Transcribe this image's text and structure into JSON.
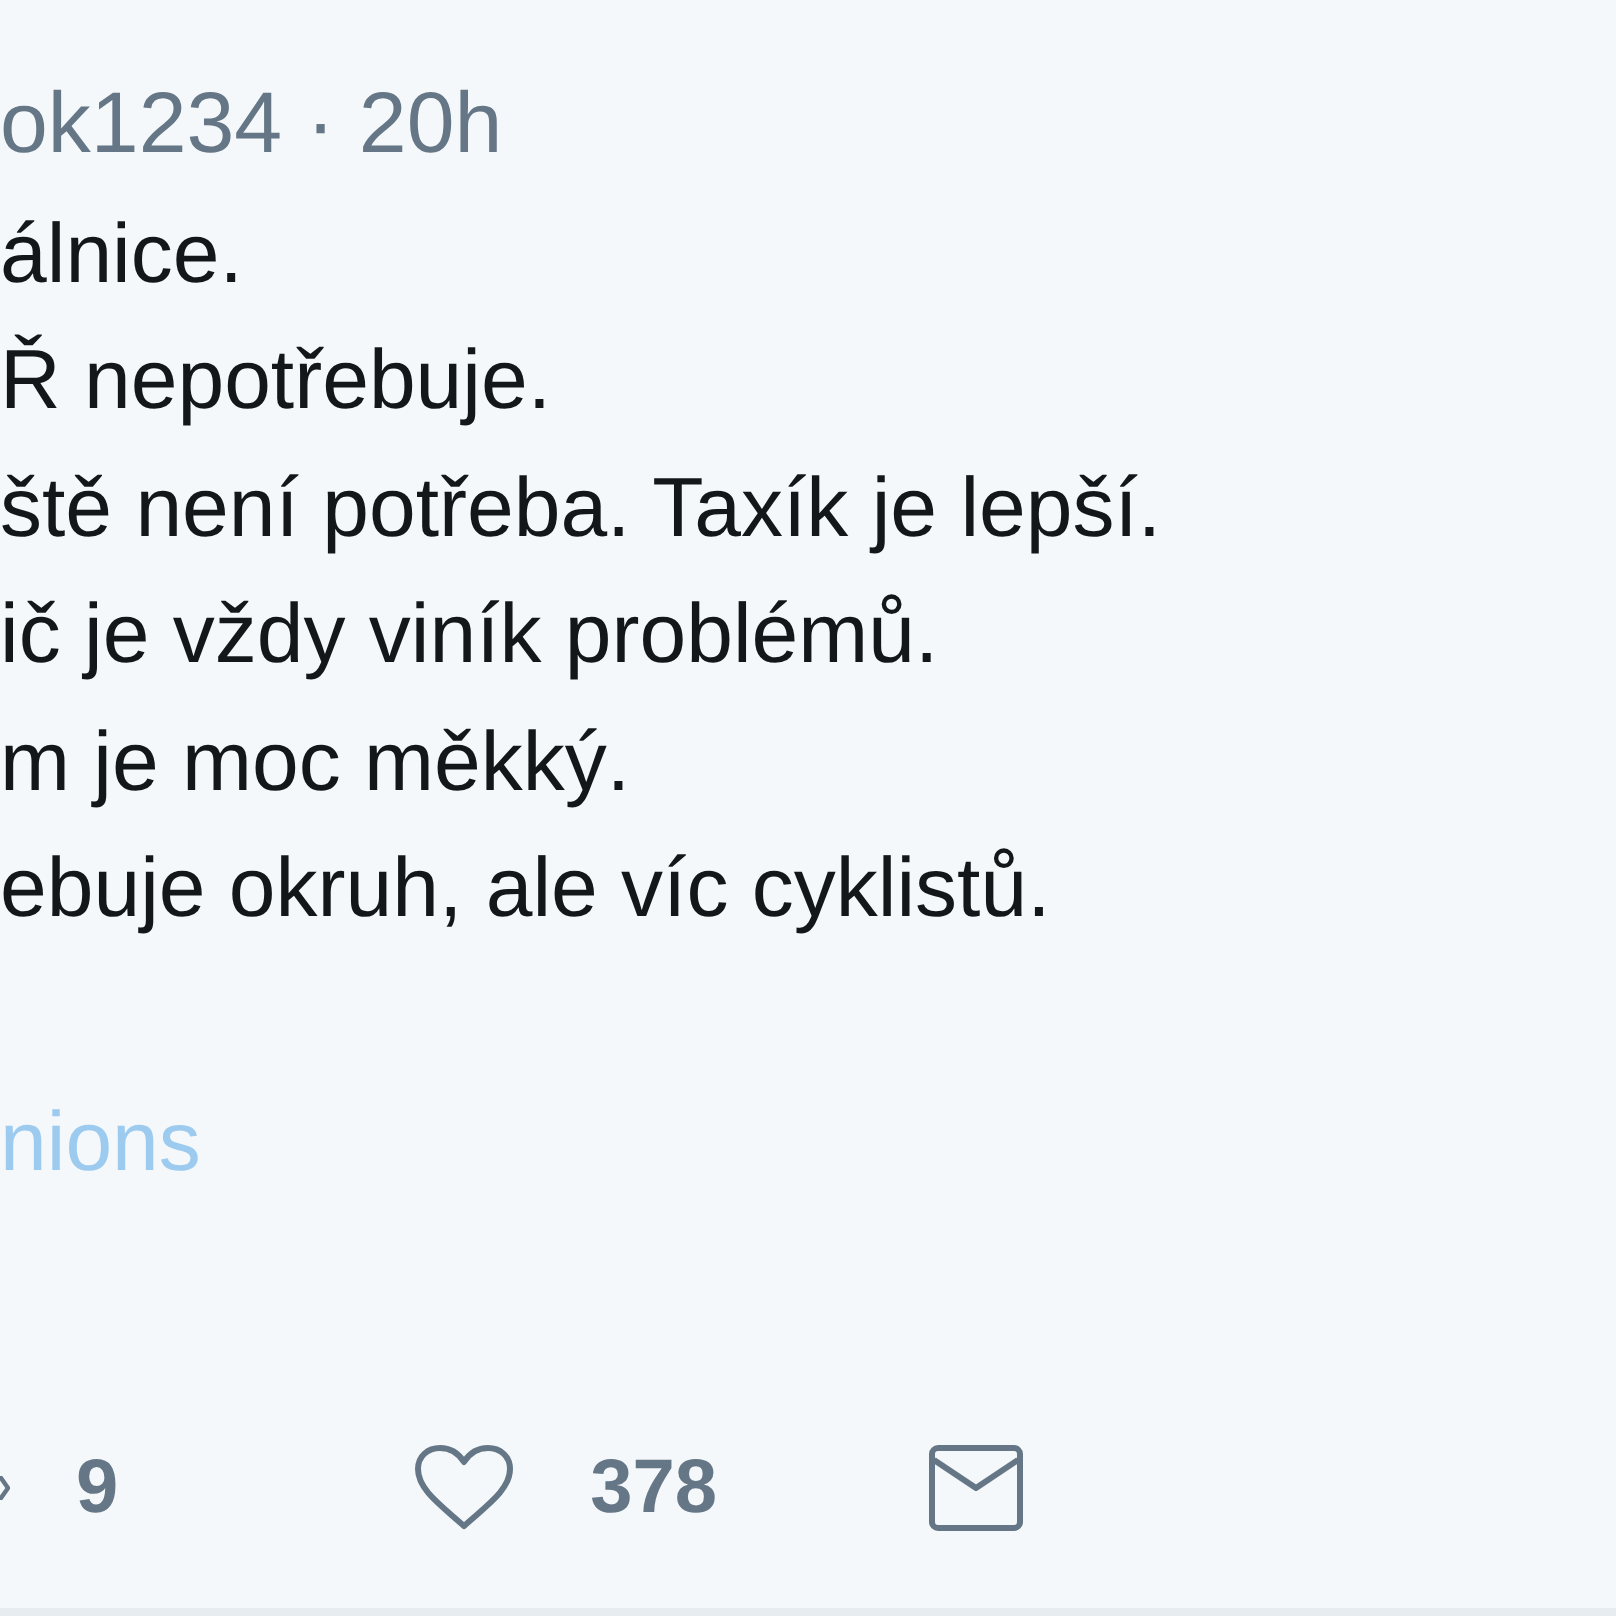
{
  "tweet": {
    "handle": "ok1234",
    "separator": "·",
    "time": "20h",
    "lines": [
      "álnice.",
      "Ř nepotřebuje.",
      "ště není potřeba. Taxík je lepší.",
      "ič je vždy viník problémů.",
      "m je moc měkký.",
      "ebuje okruh, ale víc cyklistů."
    ],
    "link": "nions"
  },
  "actions": [
    {
      "kind": "retweet",
      "count": "9"
    },
    {
      "kind": "like",
      "count": "378"
    },
    {
      "kind": "message"
    }
  ]
}
